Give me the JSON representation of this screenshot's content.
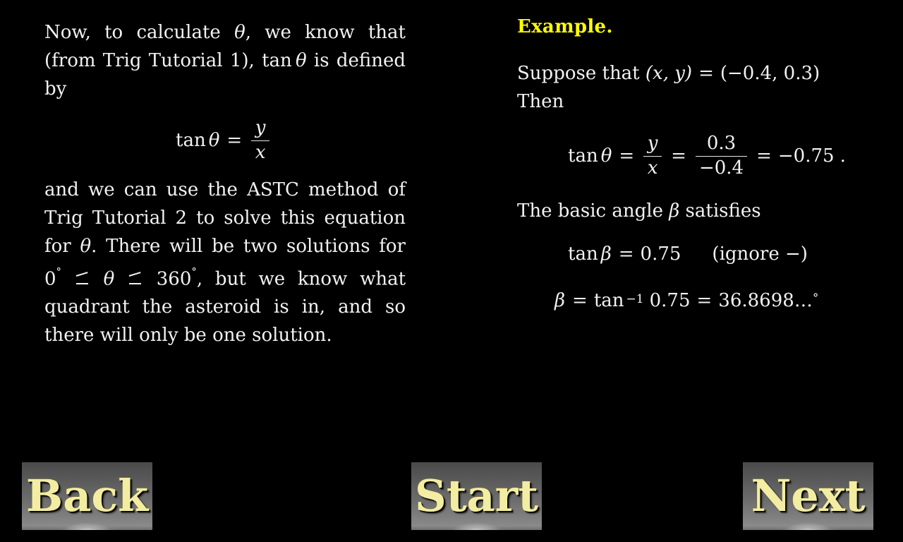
{
  "slide": {
    "background_color": "#000000",
    "text_color": "#f2f2f2",
    "accent_color": "#ffff00",
    "button_text_color": "#f3eda4"
  },
  "left_column": {
    "paragraph1": {
      "line1_a": "Now, to calculate ",
      "theta": "θ",
      "line1_b": ", we know that (from Trig Tutorial 1), ",
      "tan": "tan",
      "line1_c": " is defined by"
    },
    "equation_tan": {
      "fn": "tan",
      "arg": "θ",
      "eq": "=",
      "numerator": "y",
      "denominator": "x"
    },
    "paragraph2": {
      "part1": "and we can use the ASTC method of Trig Tutorial 2 to solve this equation for ",
      "theta": "θ",
      "part2": ". There will be two solutions for ",
      "range_lo": "0",
      "deg": "°",
      "leq": "≤",
      "range_hi": "360",
      "part3": ", but we know what quadrant the asteroid is in, and so there will only be one solution."
    }
  },
  "right_column": {
    "heading": "Example.",
    "suppose": {
      "prefix": "Suppose that ",
      "point": "(x, y)",
      "eq": "=",
      "value": "(−0.4, 0.3)",
      "then": "Then"
    },
    "equation_main": {
      "fn": "tan",
      "arg": "θ",
      "eq1": "=",
      "frac1_num": "y",
      "frac1_den": "x",
      "eq2": "=",
      "frac2_num": "0.3",
      "frac2_den": "−0.4",
      "eq3": "=",
      "result": "−0.75",
      "period": "."
    },
    "basic_angle_text": {
      "prefix": "The basic angle ",
      "beta": "β",
      "suffix": " satisfies"
    },
    "equation_beta_tan": {
      "fn": "tan",
      "arg": "β",
      "eq": "=",
      "value": "0.75",
      "note": "(ignore −)"
    },
    "equation_beta_value": {
      "beta": "β",
      "eq1": "=",
      "fn": "tan",
      "exponent": "−1",
      "operand": "0.75",
      "eq2": "=",
      "value": "36.8698",
      "ellipsis": "…",
      "degree": "°"
    }
  },
  "navigation": {
    "back_label": "Back",
    "start_label": "Start",
    "next_label": "Next"
  }
}
